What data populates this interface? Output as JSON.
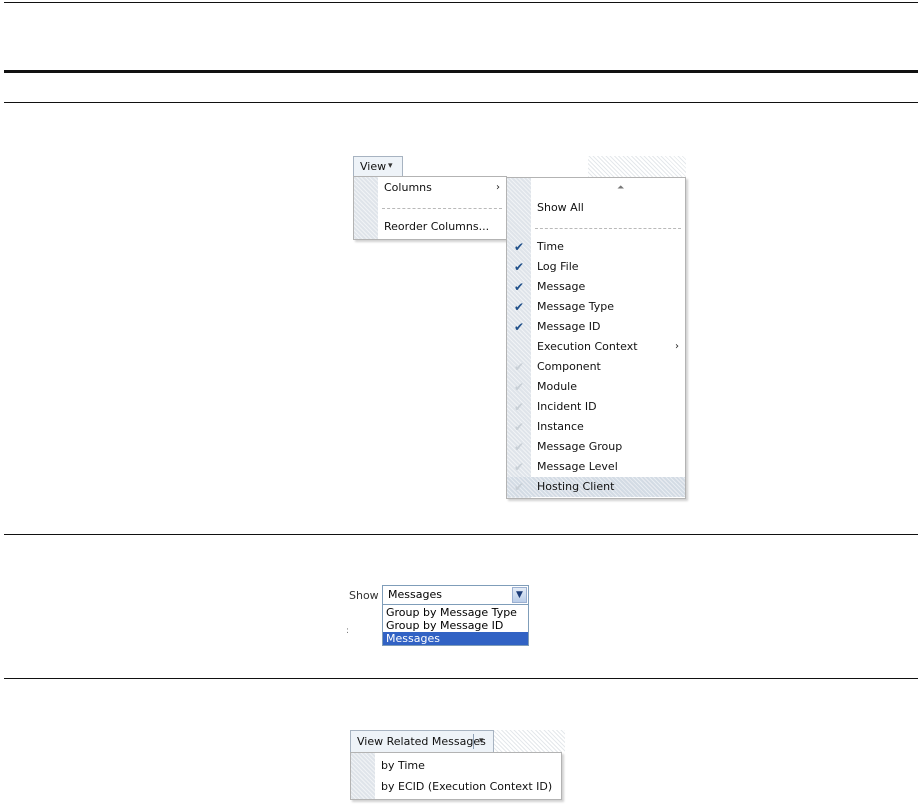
{
  "view_menu": {
    "button_label": "View",
    "items": [
      {
        "label": "Columns",
        "submenu_arrow": "›"
      },
      {
        "label": "Reorder Columns..."
      }
    ]
  },
  "columns_submenu": {
    "scroll_up_glyph": "⏶",
    "show_all": "Show All",
    "items": [
      {
        "label": "Time",
        "checked": true
      },
      {
        "label": "Log File",
        "checked": true
      },
      {
        "label": "Message",
        "checked": true
      },
      {
        "label": "Message Type",
        "checked": true
      },
      {
        "label": "Message ID",
        "checked": true
      },
      {
        "label": "Execution Context",
        "checked": false,
        "arrow": "›"
      },
      {
        "label": "Component",
        "checked": false
      },
      {
        "label": "Module",
        "checked": false
      },
      {
        "label": "Incident ID",
        "checked": false
      },
      {
        "label": "Instance",
        "checked": false
      },
      {
        "label": "Message Group",
        "checked": false
      },
      {
        "label": "Message Level",
        "checked": false
      },
      {
        "label": "Hosting Client",
        "checked": false
      }
    ],
    "check_glyph": "✔"
  },
  "show_select": {
    "label": "Show",
    "value": "Messages",
    "options": [
      "Group by Message Type",
      "Group by Message ID",
      "Messages"
    ],
    "selected_index": 2
  },
  "related_messages": {
    "button_label": "View Related Messages",
    "items": [
      "by Time",
      "by ECID (Execution Context ID)"
    ]
  },
  "colors": {
    "gutter": "#dfe4ea",
    "check_on": "#1f4f89",
    "selection": "#3162c4"
  }
}
